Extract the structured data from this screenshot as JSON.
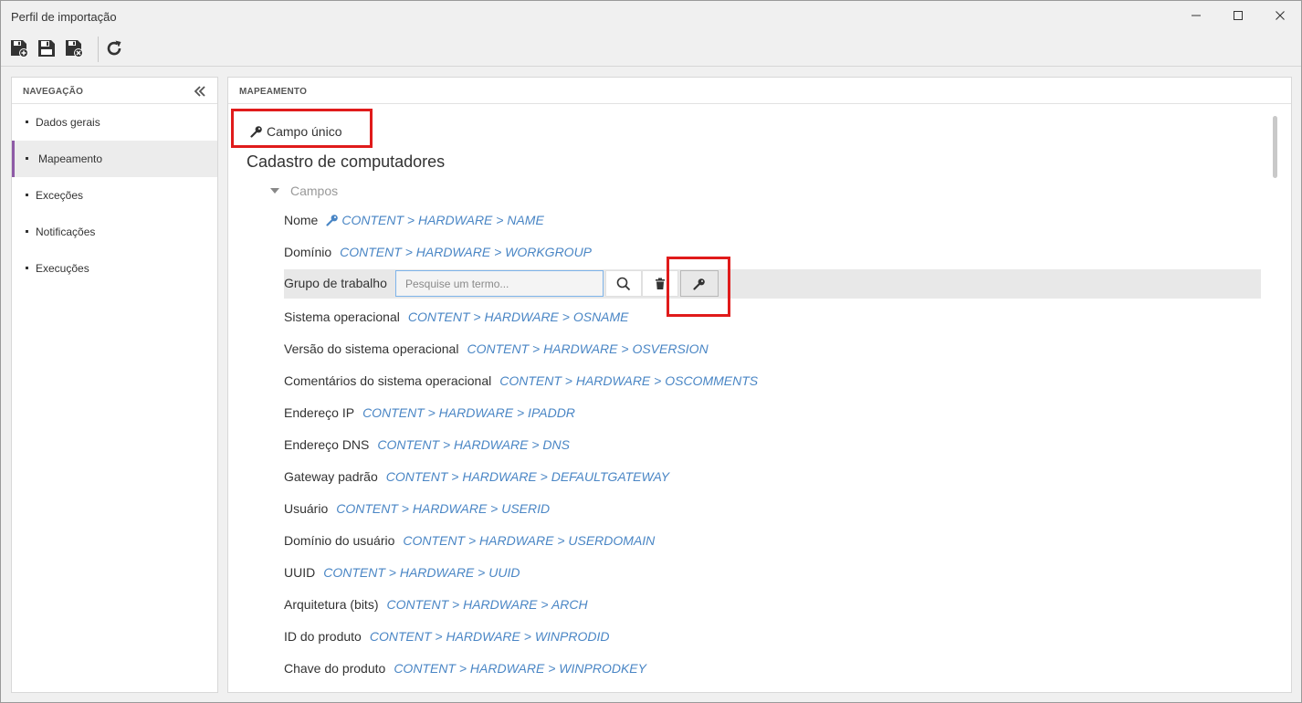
{
  "window": {
    "title": "Perfil de importação"
  },
  "toolbar": {
    "buttons": [
      {
        "icon": "save-new-icon"
      },
      {
        "icon": "save-icon"
      },
      {
        "icon": "save-close-icon"
      },
      {
        "icon": "refresh-icon"
      }
    ]
  },
  "nav": {
    "header": "NAVEGAÇÃO",
    "items": [
      {
        "label": "Dados gerais"
      },
      {
        "label": "Mapeamento"
      },
      {
        "label": "Exceções"
      },
      {
        "label": "Notificações"
      },
      {
        "label": "Execuções"
      }
    ],
    "active_index": 1
  },
  "main": {
    "header": "MAPEAMENTO",
    "unique_field_label": "Campo único",
    "section_title": "Cadastro de computadores",
    "group_label": "Campos",
    "edit_row": {
      "label": "Grupo de trabalho",
      "placeholder": "Pesquise um termo..."
    },
    "fields": [
      {
        "label": "Nome",
        "path": "CONTENT > HARDWARE > NAME",
        "key": true
      },
      {
        "label": "Domínio",
        "path": "CONTENT > HARDWARE > WORKGROUP"
      },
      {
        "label": "Sistema operacional",
        "path": "CONTENT > HARDWARE > OSNAME"
      },
      {
        "label": "Versão do sistema operacional",
        "path": "CONTENT > HARDWARE > OSVERSION"
      },
      {
        "label": "Comentários do sistema operacional",
        "path": "CONTENT > HARDWARE > OSCOMMENTS"
      },
      {
        "label": "Endereço IP",
        "path": "CONTENT > HARDWARE > IPADDR"
      },
      {
        "label": "Endereço DNS",
        "path": "CONTENT > HARDWARE > DNS"
      },
      {
        "label": "Gateway padrão",
        "path": "CONTENT > HARDWARE > DEFAULTGATEWAY"
      },
      {
        "label": "Usuário",
        "path": "CONTENT > HARDWARE > USERID"
      },
      {
        "label": "Domínio do usuário",
        "path": "CONTENT > HARDWARE > USERDOMAIN"
      },
      {
        "label": "UUID",
        "path": "CONTENT > HARDWARE > UUID"
      },
      {
        "label": "Arquitetura (bits)",
        "path": "CONTENT > HARDWARE > ARCH"
      },
      {
        "label": "ID do produto",
        "path": "CONTENT > HARDWARE > WINPRODID"
      },
      {
        "label": "Chave do produto",
        "path": "CONTENT > HARDWARE > WINPRODKEY"
      }
    ]
  },
  "colors": {
    "accent": "#8e5aa6",
    "link": "#4a86c5",
    "highlight": "#e01b1b"
  }
}
